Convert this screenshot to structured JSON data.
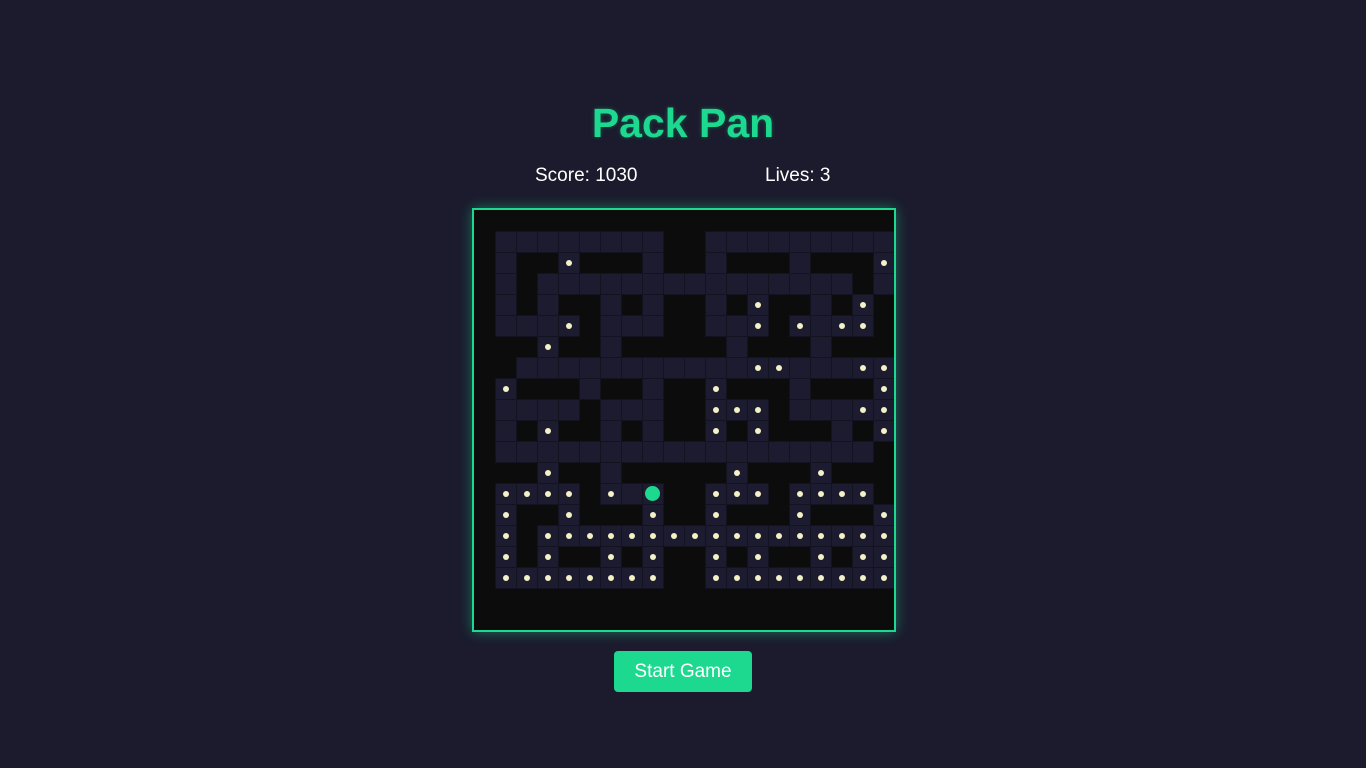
{
  "game": {
    "title": "Pack Pan",
    "score_text": "Score: 1030",
    "lives_text": "Lives: 3",
    "start_button_label": "Start Game"
  },
  "colors": {
    "background": "#1b1b2d",
    "accent": "#1dd98f",
    "board_background": "#0c0c0c",
    "path_tile": "#1c1b30",
    "pellet": "#f4f1c6"
  },
  "maze": [
    ".....................",
    ".PPPPPPPP..PPPPPPPPP.",
    ".P..o...P..P...P...o.",
    ".P.PPPPPPPPPPPPPPP.PP",
    ".P.P..P.P..P.o..P.o..",
    ".PPPo.PPP..PPo.oPoo..",
    "...o..P.....P...P....",
    "..PPPPPPPPPPPooPPPoo.",
    ".o...P..P..o...P...o.",
    ".PPPP.PPP..ooo.PPPoo.",
    ".P.o..P.P..o.o...P.o.",
    ".PPPPPPPPPPPPPPPPPP..",
    "...o..P.....o...o....",
    ".oooo.oPC..ooo.oooo..",
    ".o..o...o..o...o...o.",
    ".o.ooooooooooooooooo.P",
    ".o.o..o.o..o.o..o.oo.",
    ".oooooooo..ooooooooo.",
    ".....................",
    "....................."
  ],
  "maze_legend": {
    "P": "path tile",
    "o": "path tile with pellet",
    "C": "player",
    ".": "wall"
  }
}
